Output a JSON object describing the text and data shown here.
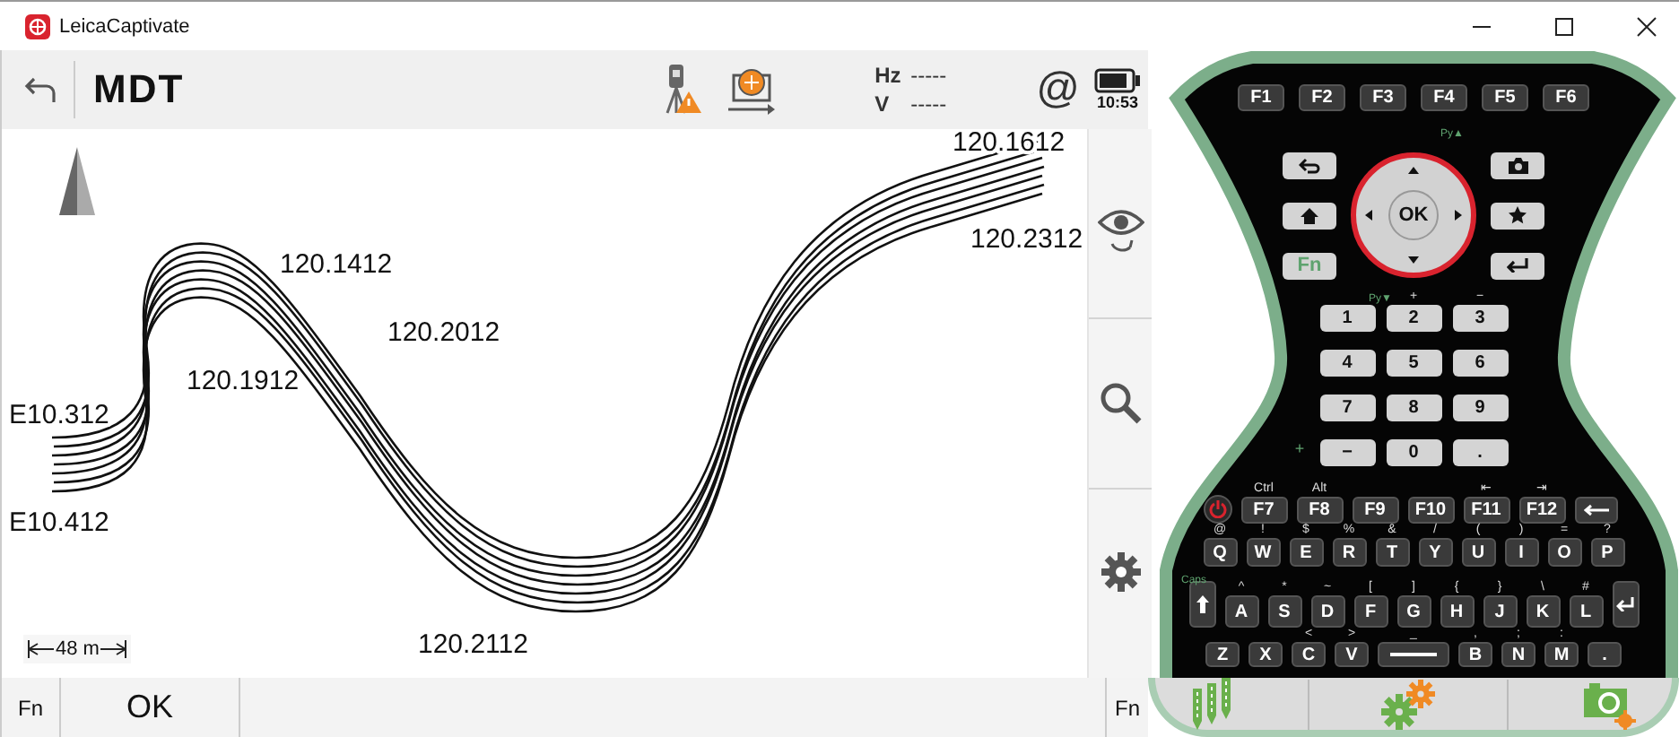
{
  "window": {
    "title": "LeicaCaptivate"
  },
  "toolbar": {
    "title": "MDT",
    "hz_label": "Hz",
    "hz_value": "-----",
    "v_label": "V",
    "v_value": "-----",
    "at_sign": "@",
    "time": "10:53"
  },
  "map": {
    "labels": [
      "120.1612",
      "120.2312",
      "120.1412",
      "120.2012",
      "120.1912",
      "E10.312",
      "E10.412",
      "120.2112"
    ],
    "scale": "48 m"
  },
  "bottom_bar": {
    "fn_left": "Fn",
    "ok": "OK",
    "fn_right": "Fn"
  },
  "keypad": {
    "function_keys": [
      "F1",
      "F2",
      "F3",
      "F4",
      "F5",
      "F6"
    ],
    "ok_label": "OK",
    "fn_label": "Fn",
    "page_up_hint": "Py▲",
    "page_down_hint": "Py▼",
    "number_rows": [
      {
        "keys": [
          {
            "label": "1"
          },
          {
            "label": "2",
            "hint": "+"
          },
          {
            "label": "3",
            "hint": "−"
          }
        ]
      },
      {
        "keys": [
          {
            "label": "4"
          },
          {
            "label": "5"
          },
          {
            "label": "6"
          }
        ]
      },
      {
        "keys": [
          {
            "label": "7"
          },
          {
            "label": "8"
          },
          {
            "label": "9"
          }
        ]
      },
      {
        "side": "+",
        "keys": [
          {
            "label": "−"
          },
          {
            "label": "0"
          },
          {
            "label": "."
          }
        ]
      }
    ],
    "fkey_row": [
      {
        "label": "F7",
        "hint": "Ctrl"
      },
      {
        "label": "F8",
        "hint": "Alt"
      },
      {
        "label": "F9"
      },
      {
        "label": "F10"
      },
      {
        "label": "F11",
        "hint": "⇤"
      },
      {
        "label": "F12",
        "hint": "⇥"
      }
    ],
    "letter_rows": [
      [
        {
          "kind": "letter",
          "label": "Q",
          "hint": "@"
        },
        {
          "kind": "letter",
          "label": "W",
          "hint": "!"
        },
        {
          "kind": "letter",
          "label": "E",
          "hint": "$"
        },
        {
          "kind": "letter",
          "label": "R",
          "hint": "%"
        },
        {
          "kind": "letter",
          "label": "T",
          "hint": "&"
        },
        {
          "kind": "letter",
          "label": "Y",
          "hint": "/"
        },
        {
          "kind": "letter",
          "label": "U",
          "hint": "("
        },
        {
          "kind": "letter",
          "label": "I",
          "hint": ")"
        },
        {
          "kind": "letter",
          "label": "O",
          "hint": "="
        },
        {
          "kind": "letter",
          "label": "P",
          "hint": "?"
        }
      ],
      [
        {
          "kind": "letter",
          "label": "A",
          "hint": "^"
        },
        {
          "kind": "letter",
          "label": "S",
          "hint": "*"
        },
        {
          "kind": "letter",
          "label": "D",
          "hint": "~"
        },
        {
          "kind": "letter",
          "label": "F",
          "hint": "["
        },
        {
          "kind": "letter",
          "label": "G",
          "hint": "]"
        },
        {
          "kind": "letter",
          "label": "H",
          "hint": "{"
        },
        {
          "kind": "letter",
          "label": "J",
          "hint": "}"
        },
        {
          "kind": "letter",
          "label": "K",
          "hint": "\\"
        },
        {
          "kind": "letter",
          "label": "L",
          "hint": "#"
        }
      ],
      [
        {
          "kind": "letter",
          "label": "Z"
        },
        {
          "kind": "letter",
          "label": "X"
        },
        {
          "kind": "letter",
          "label": "C",
          "hint": "<"
        },
        {
          "kind": "letter",
          "label": "V",
          "hint": ">"
        },
        {
          "kind": "space",
          "hint": "_"
        },
        {
          "kind": "letter",
          "label": "B",
          "hint": ","
        },
        {
          "kind": "letter",
          "label": "N",
          "hint": ";"
        },
        {
          "kind": "letter",
          "label": "M",
          "hint": ":"
        },
        {
          "kind": "letter",
          "label": "."
        }
      ]
    ],
    "caps_label": "Caps"
  }
}
